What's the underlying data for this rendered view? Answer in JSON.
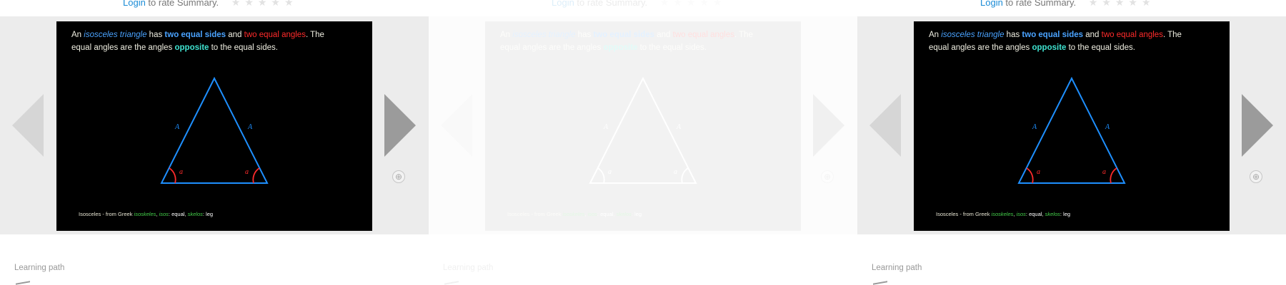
{
  "panels": [
    {
      "login_text": "Login",
      "rate_text": " to rate Summary.",
      "stars": "★★★★★",
      "slide": {
        "line1_a": "An ",
        "line1_term": "isosceles triangle",
        "line1_b": " has ",
        "line1_sides": "two equal sides",
        "line1_c": " and ",
        "line1_angles": "two equal angles",
        "line1_d": ". The",
        "line2_a": "equal angles are the angles ",
        "line2_opposite": "opposite",
        "line2_b": " to the equal sides.",
        "side_label_left": "A",
        "side_label_right": "A",
        "angle_label_left": "a",
        "angle_label_right": "a",
        "foot_isosceles": "Isosceles",
        "foot_from": " - from Greek ",
        "foot_isoskeles": "isoskeles",
        "foot_sep1": ", ",
        "foot_isos": "isos",
        "foot_colon1": ": ",
        "foot_equal": "equal",
        "foot_sep2": ", ",
        "foot_skelos": "skelos",
        "foot_colon2": ": ",
        "foot_leg": "leg"
      },
      "expand_icon": "⊕",
      "learning_path": "Learning path"
    },
    {
      "login_text": "Login",
      "rate_text": " to rate Summary.",
      "stars": "★★★★★",
      "slide": {
        "line1_a": "An ",
        "line1_term": "isosceles triangle",
        "line1_b": " has ",
        "line1_sides": "two equal sides",
        "line1_c": " and ",
        "line1_angles": "two equal angles",
        "line1_d": ". The",
        "line2_a": "equal angles are the angles ",
        "line2_opposite": "opposite",
        "line2_b": " to the equal sides.",
        "side_label_left": "A",
        "side_label_right": "A",
        "angle_label_left": "a",
        "angle_label_right": "a",
        "foot_isosceles": "Isosceles",
        "foot_from": " - from Greek ",
        "foot_isoskeles": "isoskeles",
        "foot_sep1": ", ",
        "foot_isos": "isos",
        "foot_colon1": ": ",
        "foot_equal": "equal",
        "foot_sep2": ", ",
        "foot_skelos": "skelos",
        "foot_colon2": ": ",
        "foot_leg": "leg"
      },
      "expand_icon": "⊕",
      "learning_path": "Learning path"
    },
    {
      "login_text": "Login",
      "rate_text": " to rate Summary.",
      "stars": "★★★★★",
      "slide": {
        "line1_a": "An ",
        "line1_term": "isosceles triangle",
        "line1_b": " has ",
        "line1_sides": "two equal sides",
        "line1_c": " and ",
        "line1_angles": "two equal angles",
        "line1_d": ". The",
        "line2_a": "equal angles are the angles ",
        "line2_opposite": "opposite",
        "line2_b": " to the equal sides.",
        "side_label_left": "A",
        "side_label_right": "A",
        "angle_label_left": "a",
        "angle_label_right": "a",
        "foot_isosceles": "Isosceles",
        "foot_from": " - from Greek ",
        "foot_isoskeles": "isoskeles",
        "foot_sep1": ", ",
        "foot_isos": "isos",
        "foot_colon1": ": ",
        "foot_equal": "equal",
        "foot_sep2": ", ",
        "foot_skelos": "skelos",
        "foot_colon2": ": ",
        "foot_leg": "leg"
      },
      "expand_icon": "⊕",
      "learning_path": "Learning path"
    }
  ],
  "colors": {
    "link": "#1a8bd6",
    "slide_bg": "#000000",
    "triangle": "#1e8fff",
    "angle": "#ff2b2b",
    "band": "#ececec"
  },
  "icons": {
    "prev": "left-triangle-arrow",
    "next": "right-triangle-arrow",
    "expand": "circle-plus-icon",
    "stars": "star-icon"
  }
}
